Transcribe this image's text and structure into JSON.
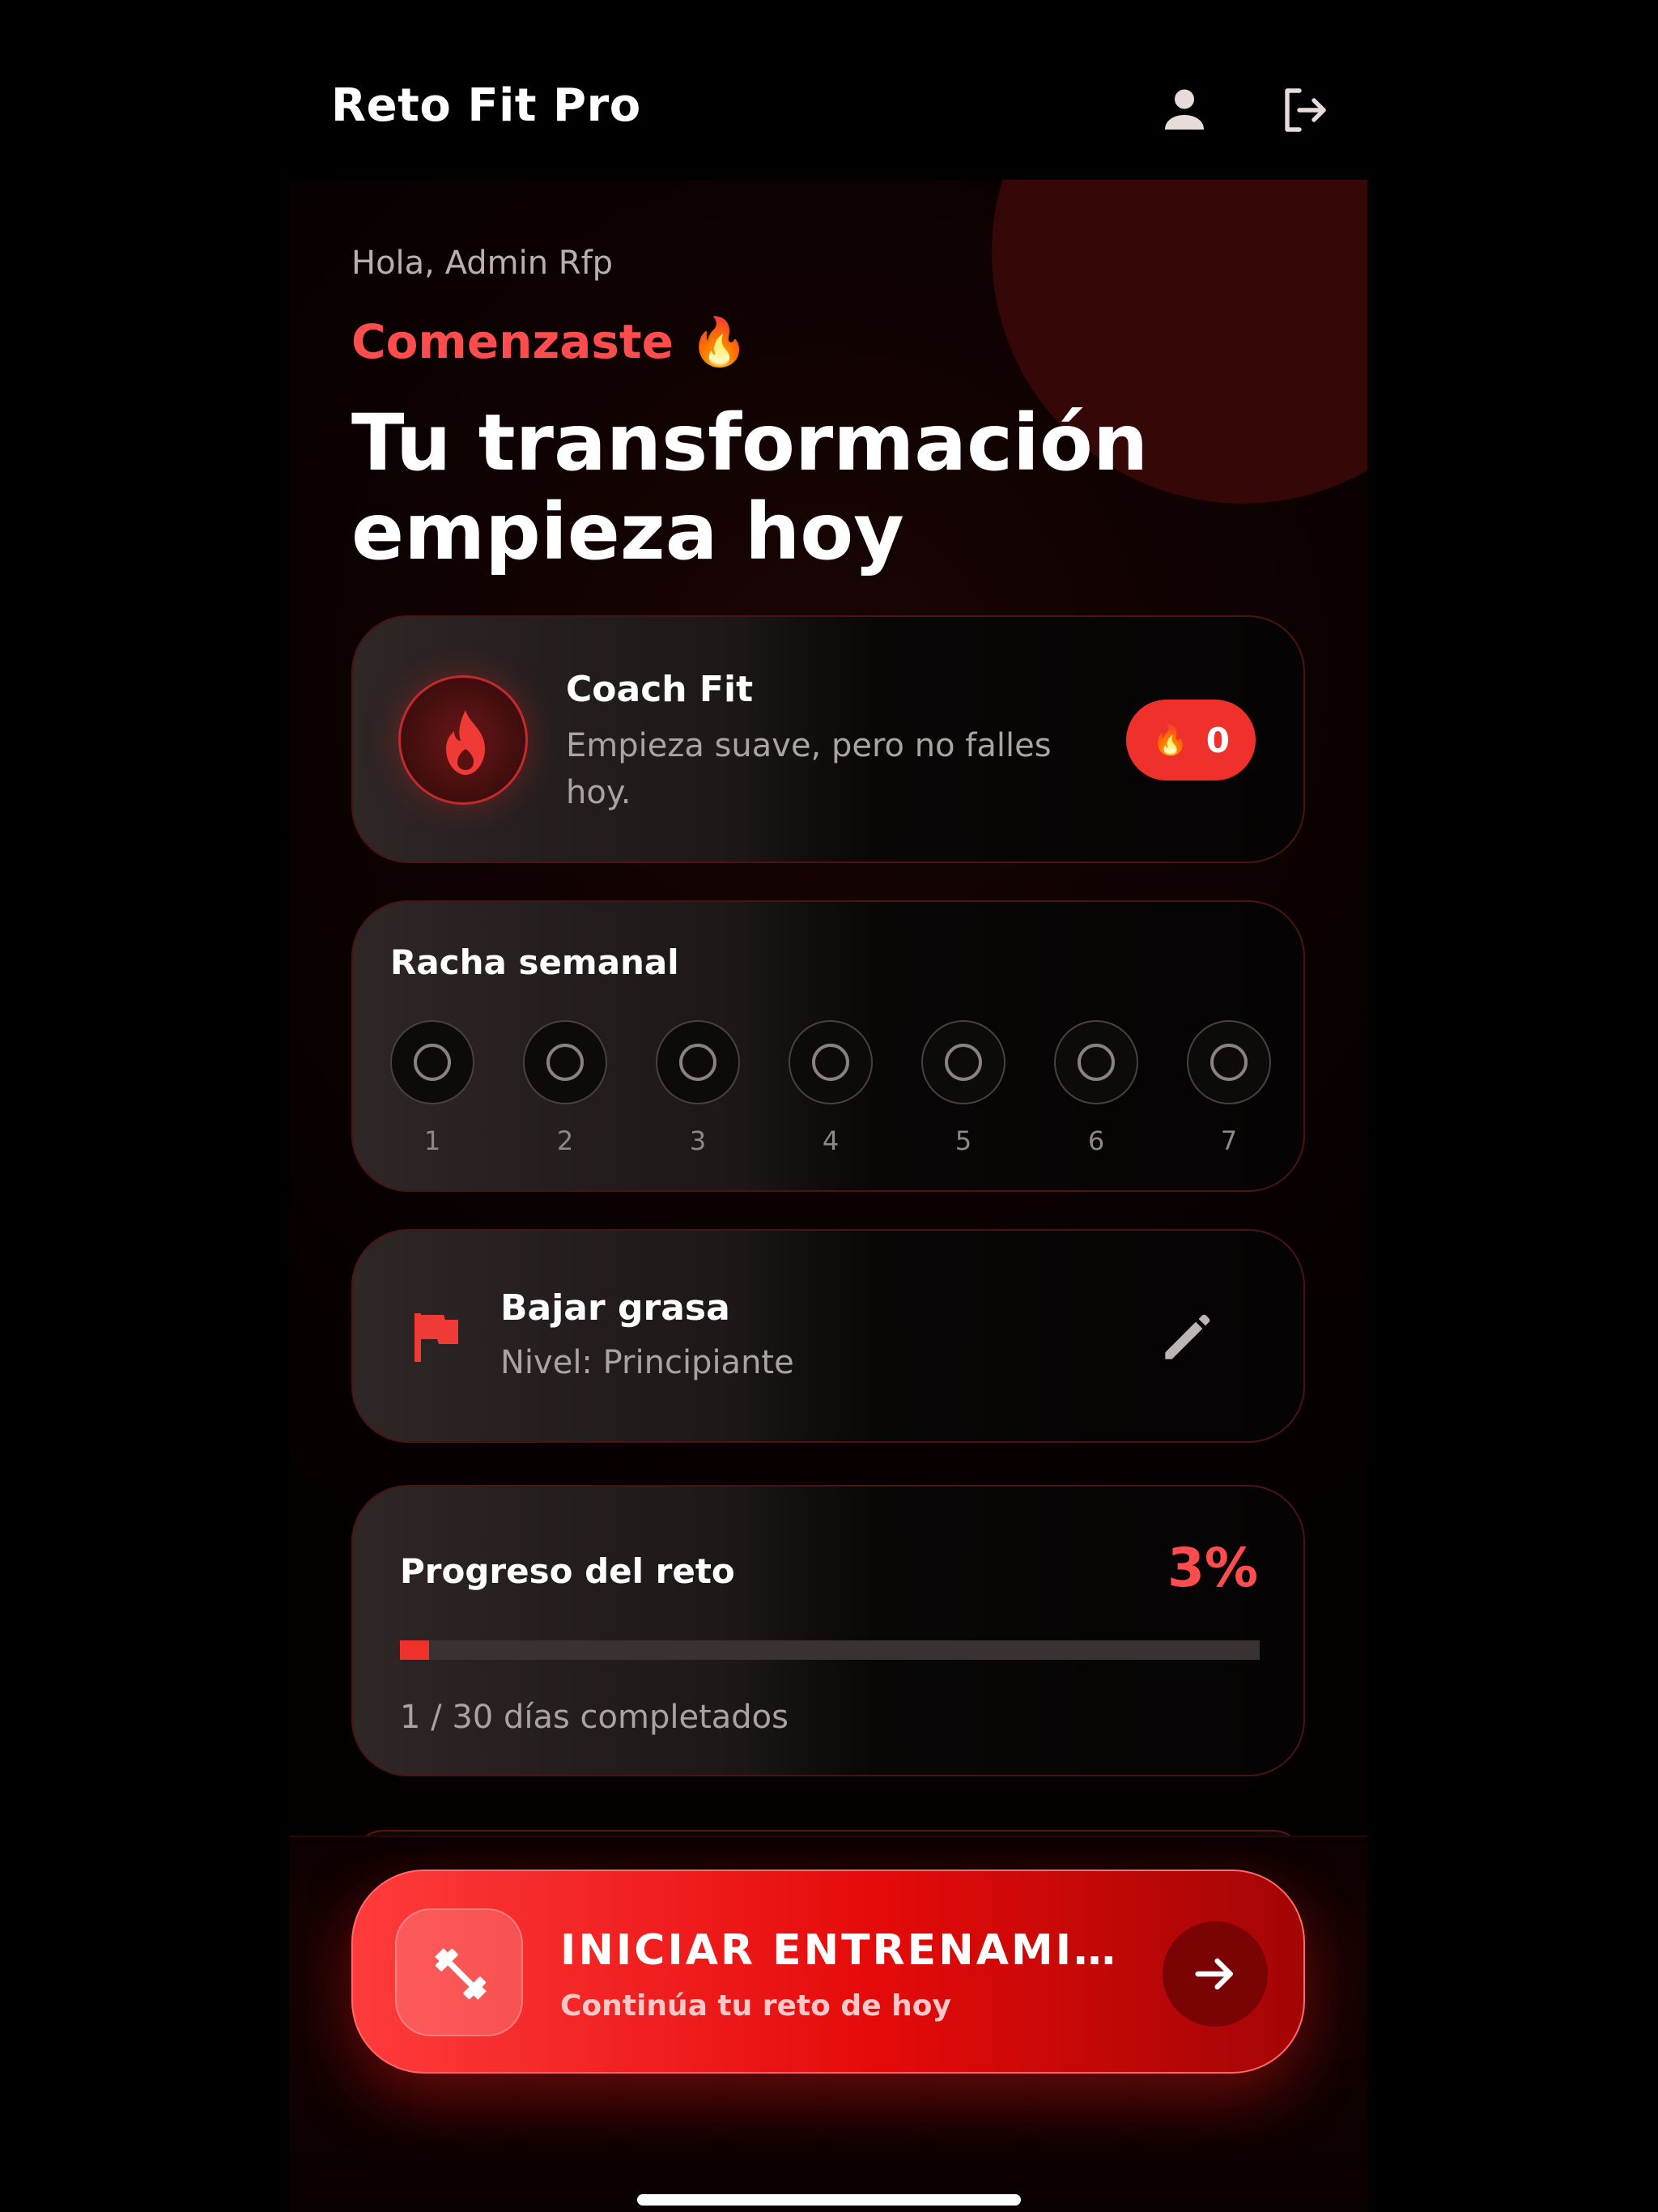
{
  "header": {
    "title": "Reto Fit Pro",
    "profile_icon": "person-icon",
    "logout_icon": "logout-icon"
  },
  "hero": {
    "greeting": "Hola, Admin Rfp",
    "kicker": "Comenzaste 🔥",
    "headline": "Tu transformación empieza hoy"
  },
  "coach": {
    "icon": "flame-icon",
    "name": "Coach Fit",
    "message": "Empieza suave, pero no falles hoy.",
    "streak_icon": "🔥",
    "streak_count": "0"
  },
  "weekly_streak": {
    "title": "Racha semanal",
    "days": [
      "1",
      "2",
      "3",
      "4",
      "5",
      "6",
      "7"
    ]
  },
  "goal": {
    "icon": "flag-icon",
    "title": "Bajar grasa",
    "level": "Nivel: Principiante",
    "edit_icon": "pencil-icon"
  },
  "progress": {
    "title": "Progreso del reto",
    "percent_label": "3%",
    "percent": 3,
    "days_label": "1 / 30 días completados"
  },
  "cta": {
    "icon": "dumbbell-icon",
    "title": "INICIAR ENTRENAMIENTO",
    "subtitle": "Continúa tu reto de hoy",
    "arrow_icon": "arrow-right-icon"
  },
  "colors": {
    "accent": "#f0302b",
    "accent_text": "#ff4d4d",
    "background": "#000000"
  }
}
